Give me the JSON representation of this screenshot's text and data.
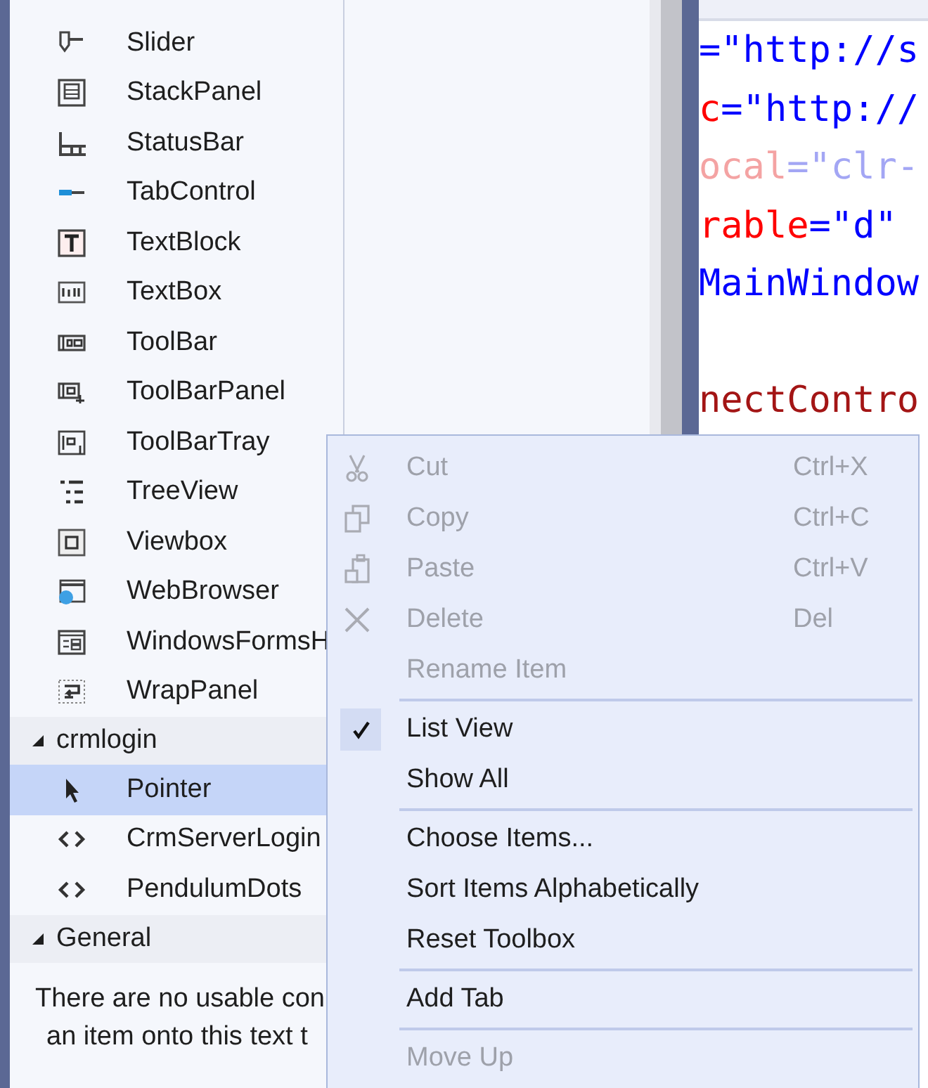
{
  "toolbox": {
    "sections": [
      {
        "items": [
          {
            "label": "Slider",
            "selected": false
          },
          {
            "label": "StackPanel",
            "selected": false
          },
          {
            "label": "StatusBar",
            "selected": false
          },
          {
            "label": "TabControl",
            "selected": false
          },
          {
            "label": "TextBlock",
            "selected": false
          },
          {
            "label": "TextBox",
            "selected": false
          },
          {
            "label": "ToolBar",
            "selected": false
          },
          {
            "label": "ToolBarPanel",
            "selected": false
          },
          {
            "label": "ToolBarTray",
            "selected": false
          },
          {
            "label": "TreeView",
            "selected": false
          },
          {
            "label": "Viewbox",
            "selected": false
          },
          {
            "label": "WebBrowser",
            "selected": false
          },
          {
            "label": "WindowsFormsH",
            "selected": false
          },
          {
            "label": "WrapPanel",
            "selected": false
          }
        ]
      },
      {
        "header": "crmlogin",
        "expanded": true,
        "items": [
          {
            "label": "Pointer",
            "selected": true
          },
          {
            "label": "CrmServerLogin",
            "selected": false
          },
          {
            "label": "PendulumDots",
            "selected": false
          }
        ]
      },
      {
        "header": "General",
        "expanded": true,
        "message_lines": [
          "There are no usable con",
          "an item onto this text t"
        ]
      }
    ]
  },
  "editor": {
    "lines": [
      {
        "gap_before": false,
        "tokens": [
          {
            "kind": "value",
            "text": "=\"http://s"
          }
        ]
      },
      {
        "gap_before": false,
        "tokens": [
          {
            "kind": "attr",
            "text": "c"
          },
          {
            "kind": "value",
            "text": "=\"http://"
          }
        ]
      },
      {
        "gap_before": false,
        "tokens": [
          {
            "kind": "faded-attr",
            "text": "ocal"
          },
          {
            "kind": "faded-value",
            "text": "=\"clr-"
          }
        ]
      },
      {
        "gap_before": false,
        "tokens": [
          {
            "kind": "attr",
            "text": "rable"
          },
          {
            "kind": "value",
            "text": "=\"d\""
          }
        ]
      },
      {
        "gap_before": false,
        "tokens": [
          {
            "kind": "value",
            "text": "MainWindow"
          }
        ]
      },
      {
        "gap_before": true,
        "tokens": [
          {
            "kind": "element",
            "text": "nectContro"
          }
        ]
      }
    ]
  },
  "context_menu": {
    "items": [
      {
        "kind": "item",
        "label": "Cut",
        "shortcut": "Ctrl+X",
        "disabled": true,
        "checked": false
      },
      {
        "kind": "item",
        "label": "Copy",
        "shortcut": "Ctrl+C",
        "disabled": true,
        "checked": false
      },
      {
        "kind": "item",
        "label": "Paste",
        "shortcut": "Ctrl+V",
        "disabled": true,
        "checked": false
      },
      {
        "kind": "item",
        "label": "Delete",
        "shortcut": "Del",
        "disabled": true,
        "checked": false
      },
      {
        "kind": "item",
        "label": "Rename Item",
        "disabled": true,
        "checked": false
      },
      {
        "kind": "separator"
      },
      {
        "kind": "item",
        "label": "List View",
        "disabled": false,
        "checked": true
      },
      {
        "kind": "item",
        "label": "Show All",
        "disabled": false,
        "checked": false
      },
      {
        "kind": "separator"
      },
      {
        "kind": "item",
        "label": "Choose Items...",
        "disabled": false,
        "checked": false
      },
      {
        "kind": "item",
        "label": "Sort Items Alphabetically",
        "disabled": false,
        "checked": false
      },
      {
        "kind": "item",
        "label": "Reset Toolbox",
        "disabled": false,
        "checked": false
      },
      {
        "kind": "separator"
      },
      {
        "kind": "item",
        "label": "Add Tab",
        "disabled": false,
        "checked": false
      },
      {
        "kind": "separator"
      },
      {
        "kind": "item",
        "label": "Move Up",
        "disabled": true,
        "checked": false
      }
    ]
  }
}
